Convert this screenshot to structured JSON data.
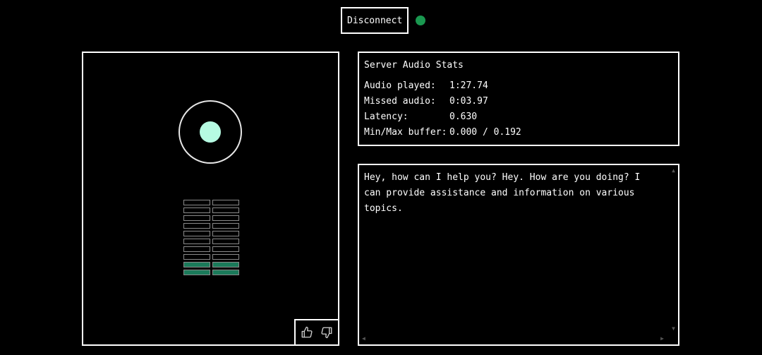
{
  "colors": {
    "background": "#000000",
    "status_connected": "#1a9850",
    "orb": "#b6fbe2",
    "meter_active": "#1b7a5a"
  },
  "header": {
    "disconnect_label": "Disconnect",
    "status": "connected"
  },
  "visualizer": {
    "meter_rows": 10,
    "meter_active_rows": 2
  },
  "feedback": {
    "thumbs_up_icon": "thumbs-up-icon",
    "thumbs_down_icon": "thumbs-down-icon"
  },
  "stats": {
    "title": "Server Audio Stats",
    "rows": [
      {
        "label": "Audio played:",
        "value": "1:27.74"
      },
      {
        "label": "Missed audio:",
        "value": "0:03.97"
      },
      {
        "label": "Latency:",
        "value": "0.630"
      },
      {
        "label": "Min/Max buffer:",
        "value": "0.000 / 0.192"
      }
    ]
  },
  "transcript": {
    "text": "Hey, how can I help you? Hey. How are you doing? I can provide assistance and information on various topics."
  }
}
